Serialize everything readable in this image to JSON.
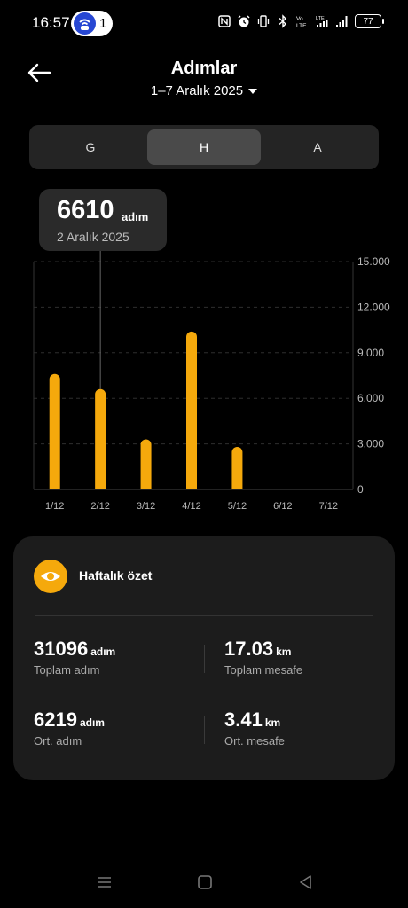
{
  "status_bar": {
    "time": "16:57",
    "hotspot_count": "1",
    "battery": "77",
    "icons": [
      "nfc-icon",
      "alarm-icon",
      "vibrate-icon",
      "bluetooth-icon",
      "volte-icon",
      "lte-signal-icon",
      "signal-icon",
      "battery-icon"
    ]
  },
  "header": {
    "title": "Adımlar",
    "date_range": "1–7 Aralık 2025"
  },
  "period_tabs": [
    {
      "label": "G",
      "active": false
    },
    {
      "label": "H",
      "active": true
    },
    {
      "label": "A",
      "active": false
    }
  ],
  "tooltip": {
    "value": "6610",
    "unit": "adım",
    "date": "2 Aralık 2025"
  },
  "chart_data": {
    "type": "bar",
    "categories": [
      "1/12",
      "2/12",
      "3/12",
      "4/12",
      "5/12",
      "6/12",
      "7/12"
    ],
    "values": [
      7600,
      6610,
      3300,
      10400,
      2800,
      0,
      0
    ],
    "y_ticks": [
      "15.000",
      "12.000",
      "9.000",
      "6.000",
      "3.000",
      "0"
    ],
    "y_tick_values": [
      15000,
      12000,
      9000,
      6000,
      3000,
      0
    ],
    "ylim": [
      0,
      15000
    ],
    "selected_index": 1,
    "bar_color": "#f5a90c",
    "grid": true
  },
  "summary": {
    "title": "Haftalık özet",
    "icon": "eye-icon",
    "accent_color": "#f5a90c",
    "stats": [
      {
        "value": "31096",
        "unit": "adım",
        "label": "Toplam adım"
      },
      {
        "value": "17.03",
        "unit": "km",
        "label": "Toplam mesafe"
      },
      {
        "value": "6219",
        "unit": "adım",
        "label": "Ort. adım"
      },
      {
        "value": "3.41",
        "unit": "km",
        "label": "Ort. mesafe"
      }
    ]
  }
}
